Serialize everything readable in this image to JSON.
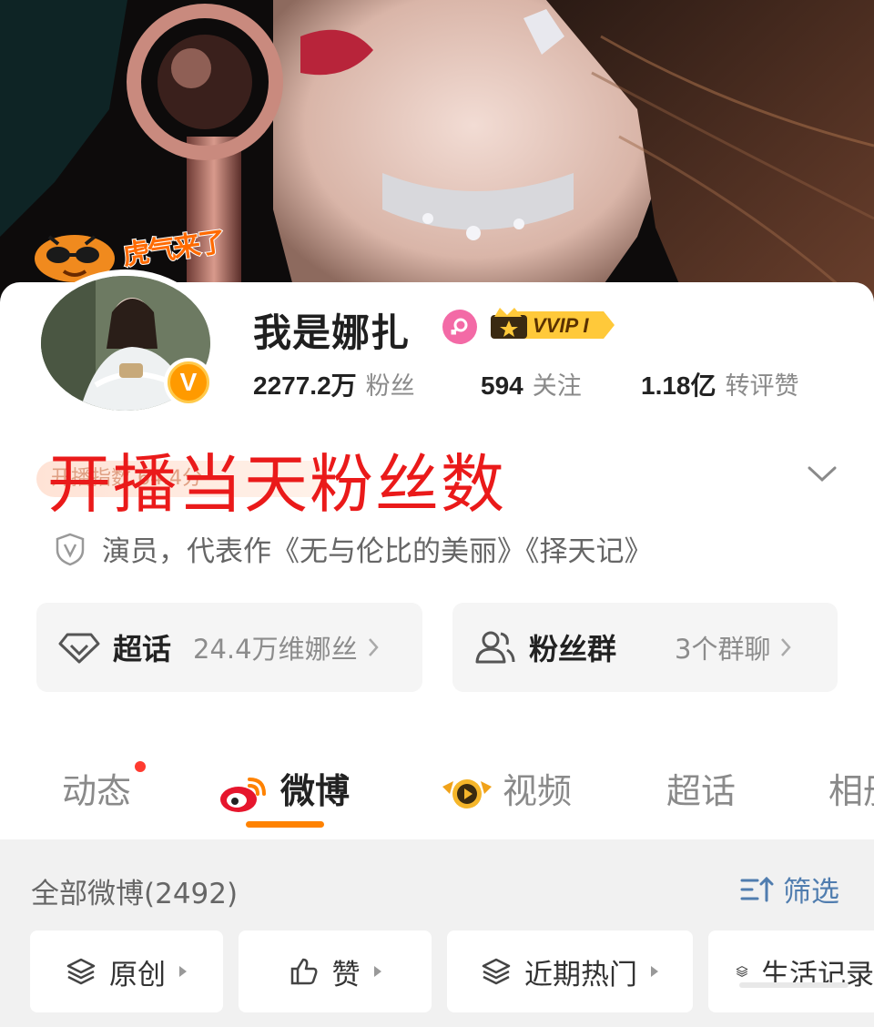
{
  "profile": {
    "username": "我是娜扎",
    "vip_label": "VVIP I",
    "banner_sticker": "虎气来了",
    "verified_mark": "V",
    "stats": [
      {
        "value": "2277.2万",
        "label": "粉丝"
      },
      {
        "value": "594",
        "label": "关注"
      },
      {
        "value": "1.18亿",
        "label": "转评赞"
      }
    ],
    "faded_row_text": "开播指数 64.4分",
    "bio": "演员，代表作《无与伦比的美丽》《择天记》"
  },
  "annotation": {
    "text": "开播当天粉丝数",
    "color": "#ea1a1a"
  },
  "boxes": {
    "chaohua": {
      "title": "超话",
      "subtitle": "24.4万维娜丝"
    },
    "fans_group": {
      "title": "粉丝群",
      "subtitle": "3个群聊"
    }
  },
  "tabs": [
    {
      "label": "动态",
      "has_dot": true,
      "active": false
    },
    {
      "label": "微博",
      "has_dot": false,
      "active": true,
      "icon": "weibo-logo-icon"
    },
    {
      "label": "视频",
      "has_dot": false,
      "active": false,
      "icon": "video-badge-icon"
    },
    {
      "label": "超话",
      "has_dot": false,
      "active": false
    },
    {
      "label": "相册",
      "has_dot": false,
      "active": false
    }
  ],
  "feed": {
    "title": "全部微博(2492)",
    "filter_label": "筛选",
    "chips": [
      {
        "label": "原创",
        "icon": "layers-icon"
      },
      {
        "label": "赞",
        "icon": "thumbs-up-icon"
      },
      {
        "label": "近期热门",
        "icon": "layers-icon"
      },
      {
        "label": "生活记录",
        "icon": "layers-icon"
      }
    ]
  },
  "colors": {
    "accent_orange": "#ff8200",
    "link_blue": "#507daf",
    "annotation_red": "#ea1a1a",
    "gender_pink": "#f36aa6"
  }
}
